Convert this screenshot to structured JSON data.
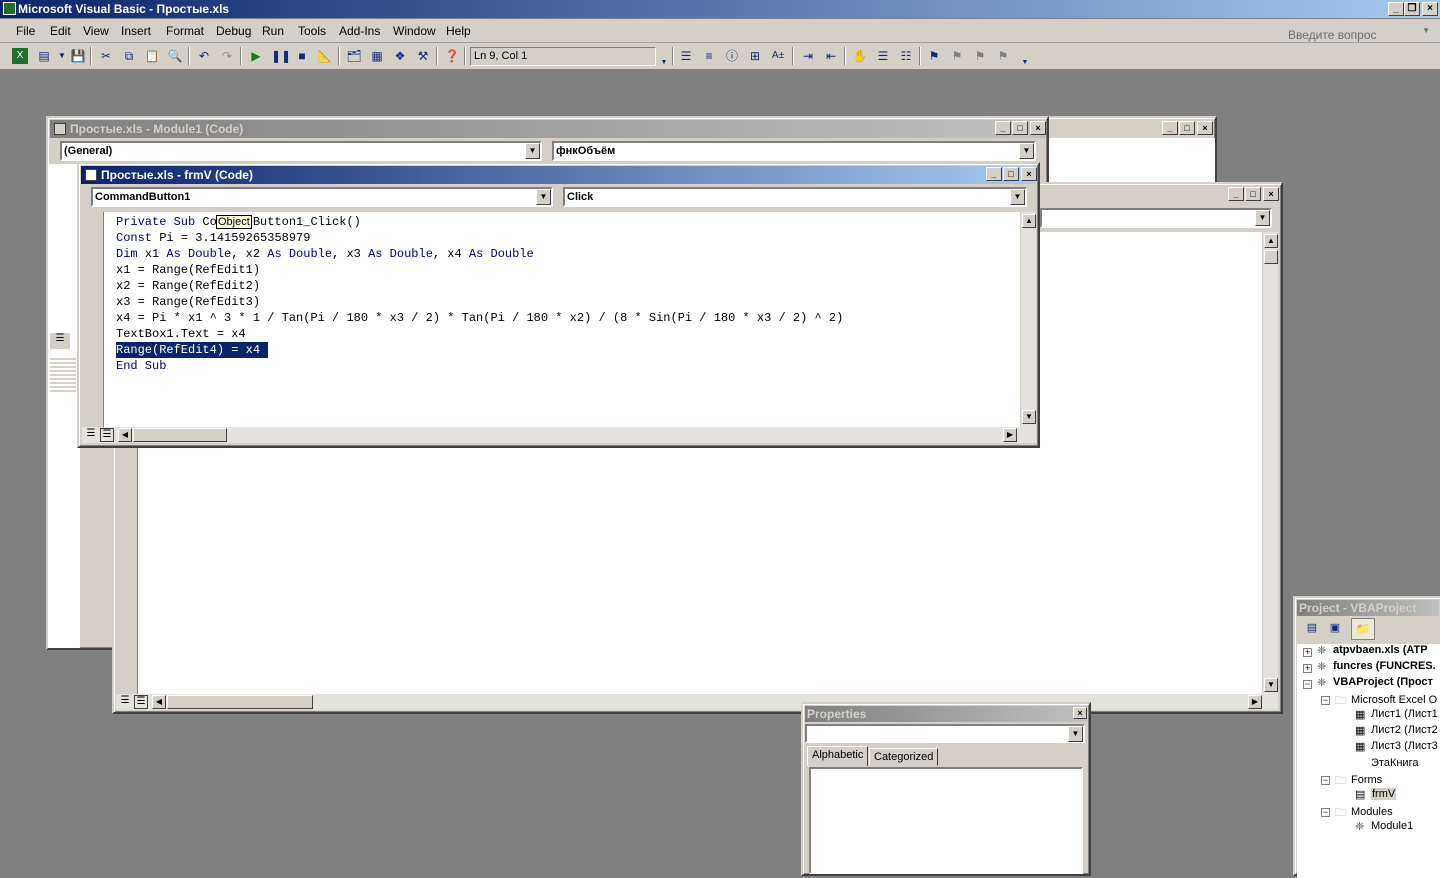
{
  "app": {
    "title": "Microsoft Visual Basic - Простые.xls"
  },
  "menu": {
    "items": [
      "File",
      "Edit",
      "View",
      "Insert",
      "Format",
      "Debug",
      "Run",
      "Tools",
      "Add-Ins",
      "Window",
      "Help"
    ],
    "help_placeholder": "Введите вопрос"
  },
  "toolbar": {
    "position": "Ln 9, Col 1"
  },
  "module_window": {
    "title": "Простые.xls - Module1 (Code)",
    "object_combo": "(General)",
    "proc_combo": "фнкОбъём"
  },
  "form_window": {
    "title": "Простые.xls - frmV (Code)",
    "object_combo": "CommandButton1",
    "proc_combo": "Click",
    "tooltip": "Object",
    "code_lines": [
      "Private Sub CommandButton1_Click()",
      "Const Pi = 3.14159265358979",
      "Dim x1 As Double, x2 As Double, x3 As Double, x4 As Double",
      "x1 = Range(RefEdit1)",
      "x2 = Range(RefEdit2)",
      "x3 = Range(RefEdit3)",
      "x4 = Pi * x1 ^ 3 * 1 / Tan(Pi / 180 * x3 / 2) * Tan(Pi / 180 * x2) / (8 * Sin(Pi / 180 * x3 / 2) ^ 2)",
      "TextBox1.Text = x4",
      "Range(RefEdit4) = x4",
      "End Sub"
    ],
    "selected_line": 8
  },
  "properties": {
    "title": "Properties",
    "tabs": [
      "Alphabetic",
      "Categorized"
    ]
  },
  "project": {
    "title": "Project - VBAProject",
    "tree": [
      {
        "label": "atpvbaen.xls (ATP",
        "bold": true,
        "icon": "vba-project-icon"
      },
      {
        "label": "funcres (FUNCRES.",
        "bold": true,
        "icon": "vba-project-icon"
      },
      {
        "label": "VBAProject (Прост",
        "bold": true,
        "icon": "vba-project-icon"
      },
      {
        "label": "Microsoft Excel O",
        "bold": false,
        "icon": "folder-icon"
      },
      {
        "label": "Лист1 (Лист1",
        "bold": false,
        "icon": "sheet-icon"
      },
      {
        "label": "Лист2 (Лист2",
        "bold": false,
        "icon": "sheet-icon"
      },
      {
        "label": "Лист3 (Лист3",
        "bold": false,
        "icon": "sheet-icon"
      },
      {
        "label": "ЭтаКнига",
        "bold": false,
        "icon": "workbook-icon"
      },
      {
        "label": "Forms",
        "bold": false,
        "icon": "folder-icon"
      },
      {
        "label": "frmV",
        "bold": false,
        "icon": "form-icon"
      },
      {
        "label": "Modules",
        "bold": false,
        "icon": "folder-icon"
      },
      {
        "label": "Module1",
        "bold": false,
        "icon": "module-icon"
      }
    ]
  }
}
